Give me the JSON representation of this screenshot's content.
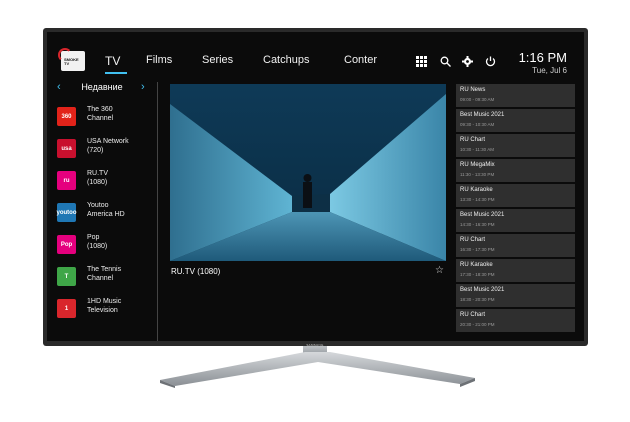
{
  "device": {
    "brand": "SAMSUNG"
  },
  "app": {
    "logo_text": "SMOKE TV"
  },
  "nav": {
    "tabs": [
      {
        "label": "TV",
        "active": true
      },
      {
        "label": "Films"
      },
      {
        "label": "Series"
      },
      {
        "label": "Catchups"
      },
      {
        "label": "Conter"
      }
    ]
  },
  "toolbar": {
    "icons": [
      "grid-icon",
      "search-icon",
      "gear-icon",
      "power-icon"
    ]
  },
  "clock": {
    "time": "1:16 PM",
    "date": "Tue, Jul 6"
  },
  "sidebar": {
    "title": "Недавние",
    "channels": [
      {
        "name": "The 360\nChannel",
        "logo": "360",
        "logo_color": "#e2231a"
      },
      {
        "name": "USA Network\n(720)",
        "logo": "usa",
        "logo_color": "#c8102e"
      },
      {
        "name": "RU.TV\n(1080)",
        "logo": "ru",
        "logo_color": "#e5007e"
      },
      {
        "name": "Youtoo\nAmerica HD",
        "logo": "youtoo",
        "logo_color": "#1f77b4"
      },
      {
        "name": "Pop\n(1080)",
        "logo": "Pop",
        "logo_color": "#e5007e"
      },
      {
        "name": "The Tennis\nChannel",
        "logo": "T",
        "logo_color": "#3fa648"
      },
      {
        "name": "1HD Music\nTelevision",
        "logo": "1",
        "logo_color": "#d9262c"
      }
    ]
  },
  "player": {
    "now_playing": "RU.TV (1080)"
  },
  "epg": [
    {
      "title": "RU News",
      "time": "09:00 - 09:30 AM"
    },
    {
      "title": "Best Music 2021",
      "time": "09:30 - 10:30 AM"
    },
    {
      "title": "RU Chart",
      "time": "10:30 - 11:30 AM"
    },
    {
      "title": "RU MegaMix",
      "time": "11:30 - 13:30 PM"
    },
    {
      "title": "RU Karaoke",
      "time": "13:30 - 14:30 PM"
    },
    {
      "title": "Best Music 2021",
      "time": "14:30 - 16:30 PM"
    },
    {
      "title": "RU Chart",
      "time": "16:30 - 17:30 PM"
    },
    {
      "title": "RU Karaoke",
      "time": "17:30 - 18:30 PM"
    },
    {
      "title": "Best Music 2021",
      "time": "18:30 - 20:30 PM"
    },
    {
      "title": "RU Chart",
      "time": "20:30 - 21:00 PM"
    }
  ],
  "colors": {
    "accent": "#41c0f0",
    "panel": "#2f2f2f",
    "background": "#0b0b0b"
  }
}
